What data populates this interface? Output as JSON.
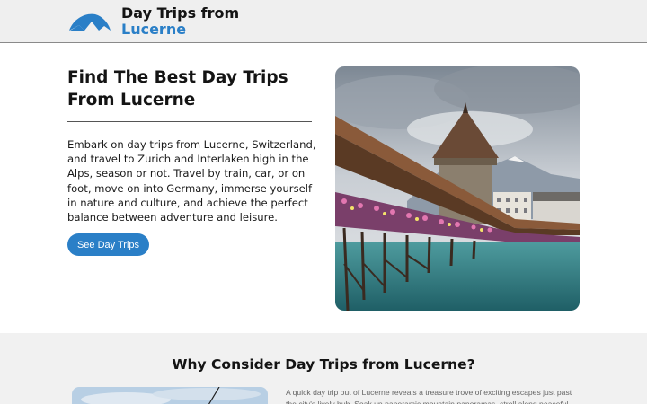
{
  "header": {
    "brand_line1": "Day Trips from",
    "brand_line2": "Lucerne",
    "logo_icon": "mountain-logo-icon"
  },
  "hero": {
    "title": "Find The Best Day Trips From Lucerne",
    "description": "Embark on day trips from Lucerne, Switzerland, and travel to Zurich and Interlaken high in the Alps, season or not. Travel by train, car, or on foot, move on into Germany, immerse yourself in nature and culture, and achieve the perfect balance between adventure and leisure.",
    "cta_label": "See Day Trips",
    "image_subject": "chapel-bridge-lucerne-photo"
  },
  "why": {
    "title": "Why Consider Day Trips from Lucerne?",
    "text": "A quick day trip out of Lucerne reveals a treasure trove of exciting escapes just past the city's lively hub. Soak up panoramic mountain panoramas, stroll along peaceful"
  },
  "colors": {
    "accent": "#2a7fc7",
    "header_bg": "#efefef",
    "section_bg": "#f1f1f1"
  }
}
